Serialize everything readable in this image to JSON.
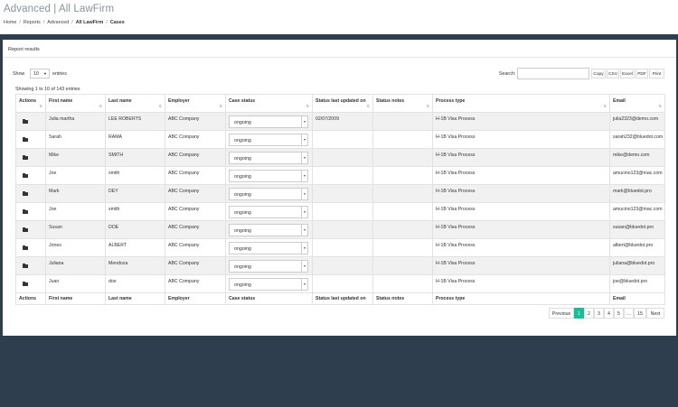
{
  "page": {
    "title": "Advanced | All LawFirm",
    "breadcrumb": [
      "Home",
      "Reports",
      "Advanced",
      "All LawFirm",
      "Cases"
    ]
  },
  "panel": {
    "title": "Report results"
  },
  "controls": {
    "show_label": "Show",
    "length_value": "10",
    "entries_label": "entries",
    "search_label": "Search:",
    "search_value": "",
    "export_buttons": [
      "Copy",
      "CSV",
      "Excel",
      "PDF",
      "Print"
    ]
  },
  "info": "Showing 1 to 10 of 143 entries",
  "table": {
    "columns": [
      "Actions",
      "First name",
      "Last name",
      "Employer",
      "Case status",
      "Status last updated on",
      "Status notes",
      "Process type",
      "Email"
    ],
    "rows": [
      {
        "first": "Julia martha",
        "last": "LEE ROBERTS",
        "employer": "ABC Company",
        "status": "ongoing",
        "updated": "02/07/2009",
        "notes": "",
        "process": "H-1B Visa Process",
        "email": "julia2323@demo.com"
      },
      {
        "first": "Sarah",
        "last": "RAMA",
        "employer": "ABC Company",
        "status": "ongoing",
        "updated": "",
        "notes": "",
        "process": "H-1B Visa Process",
        "email": "sarah232@bluedot.com"
      },
      {
        "first": "Mike",
        "last": "SMITH",
        "employer": "ABC Company",
        "status": "ongoing",
        "updated": "",
        "notes": "",
        "process": "H-1B Visa Process",
        "email": "mike@demo.com"
      },
      {
        "first": "Joe",
        "last": "smith",
        "employer": "ABC Company",
        "status": "ongoing",
        "updated": "",
        "notes": "",
        "process": "H-1B Visa Process",
        "email": "amucino123@mac.com"
      },
      {
        "first": "Mark",
        "last": "DEY",
        "employer": "ABC Company",
        "status": "ongoing",
        "updated": "",
        "notes": "",
        "process": "H-1B Visa Process",
        "email": "mark@bluedot.pro"
      },
      {
        "first": "Joe",
        "last": "smith",
        "employer": "ABC Company",
        "status": "ongoing",
        "updated": "",
        "notes": "",
        "process": "H-1B Visa Process",
        "email": "amucino123@mac.com"
      },
      {
        "first": "Susan",
        "last": "DOE",
        "employer": "ABC Company",
        "status": "ongoing",
        "updated": "",
        "notes": "",
        "process": "H-1B Visa Process",
        "email": "susan@bluedot.pro"
      },
      {
        "first": "Jones",
        "last": "ALBERT",
        "employer": "ABC Company",
        "status": "ongoing",
        "updated": "",
        "notes": "",
        "process": "H-1B Visa Process",
        "email": "albert@bluedot.pro"
      },
      {
        "first": "Juliana",
        "last": "Mendoza",
        "employer": "ABC Company",
        "status": "ongoing",
        "updated": "",
        "notes": "",
        "process": "H-1B Visa Process",
        "email": "juliana@bluedot.pro"
      },
      {
        "first": "Juan",
        "last": "doe",
        "employer": "ABC Company",
        "status": "ongoing",
        "updated": "",
        "notes": "",
        "process": "H-1B Visa Process",
        "email": "joe@bluedot.pro"
      }
    ],
    "footer_columns": [
      "Actions",
      "First name",
      "Last name",
      "Employer",
      "Case status",
      "Status last updated on",
      "Status notes",
      "Process type",
      "Email"
    ]
  },
  "pagination": {
    "previous": "Previous",
    "pages": [
      "1",
      "2",
      "3",
      "4",
      "5",
      "…",
      "15"
    ],
    "active": "1",
    "next": "Next"
  },
  "colors": {
    "background": "#2e3e4e",
    "accent": "#1abc9c",
    "stripe": "#f1f1f1"
  }
}
